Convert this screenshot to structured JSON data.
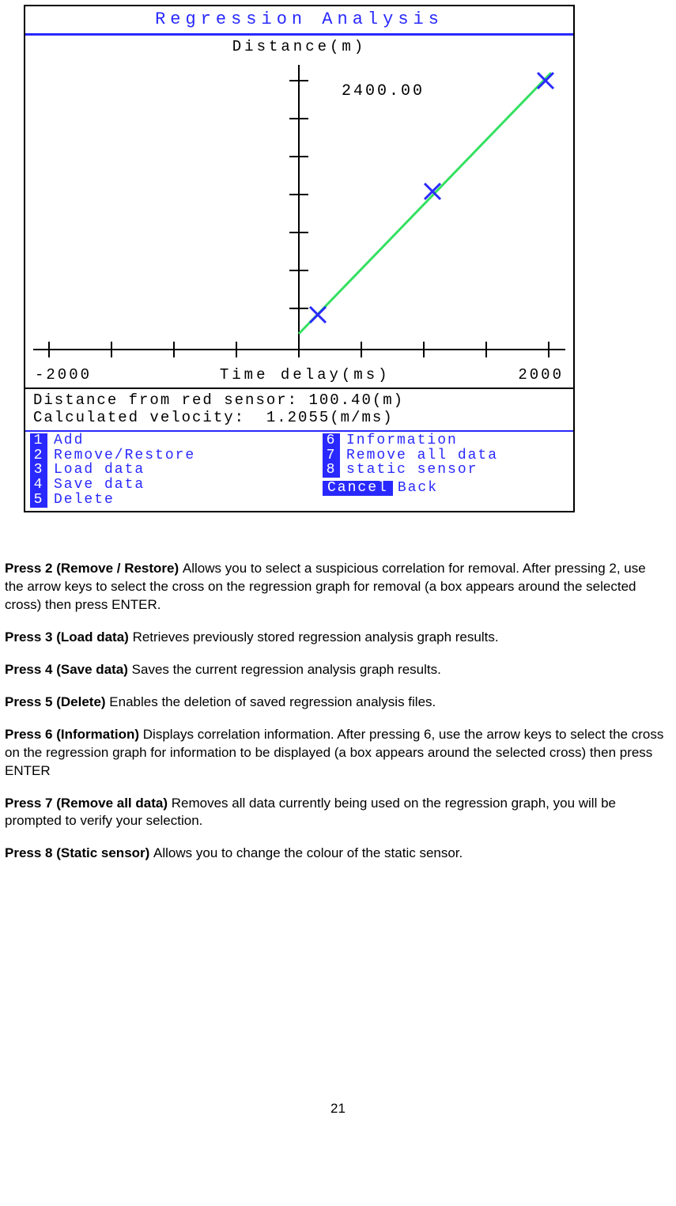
{
  "screenshot": {
    "title": "Regression Analysis",
    "y_label": "Distance(m)",
    "y_max_value": "2400.00",
    "x_min": "-2000",
    "x_label": "Time delay(ms)",
    "x_max": "2000",
    "status_line1": "Distance from red sensor: 100.40(m)",
    "status_line2": "Calculated velocity:  1.2055(m/ms)",
    "menu_left": [
      {
        "n": "1",
        "label": "Add"
      },
      {
        "n": "2",
        "label": "Remove/Restore"
      },
      {
        "n": "3",
        "label": "Load data"
      },
      {
        "n": "4",
        "label": "Save data"
      },
      {
        "n": "5",
        "label": "Delete"
      }
    ],
    "menu_right": [
      {
        "n": "6",
        "label": "Information"
      },
      {
        "n": "7",
        "label": "Remove all data"
      },
      {
        "n": "8",
        "label": "static sensor"
      }
    ],
    "cancel_badge": "Cancel",
    "cancel_label": "Back"
  },
  "chart_data": {
    "type": "scatter",
    "title": "Regression Analysis",
    "xlabel": "Time delay(ms)",
    "ylabel": "Distance(m)",
    "xlim": [
      -2000,
      2000
    ],
    "ylim": [
      0,
      2400
    ],
    "x": [
      100,
      1050,
      1950
    ],
    "y": [
      300,
      1350,
      2350
    ],
    "fit_line": {
      "slope": 1.2055,
      "points": [
        [
          0,
          200
        ],
        [
          2000,
          2400
        ]
      ]
    },
    "annotations": {
      "y_max_label": "2400.00"
    }
  },
  "text": {
    "p2_bold": "Press 2 (Remove / Restore) ",
    "p2_rest": "Allows you to select a suspicious correlation for removal. After pressing 2, use the arrow keys to select the cross on the regression graph for removal (a box appears around the selected cross) then press ENTER.",
    "p3_bold": "Press 3 (Load data) ",
    "p3_rest": "Retrieves previously stored regression analysis graph results.",
    "p4_bold": "Press 4 (Save data) ",
    "p4_rest": "Saves the current regression analysis graph results.",
    "p5_bold": "Press 5 (Delete) ",
    "p5_rest": "Enables the deletion of saved regression analysis files.",
    "p6_bold": "Press 6 (Information) ",
    "p6_rest": "Displays correlation information. After pressing 6, use the arrow keys to select the cross on the regression graph for information to be displayed (a box appears around the selected cross) then press ENTER",
    "p7_bold": "Press 7 (Remove all data) ",
    "p7_rest": "Removes all data currently being used on the regression graph, you will be prompted to verify your selection.",
    "p8_bold": "Press 8 (Static sensor) ",
    "p8_rest": "Allows you to change the colour of the static sensor."
  },
  "page_number": "21"
}
